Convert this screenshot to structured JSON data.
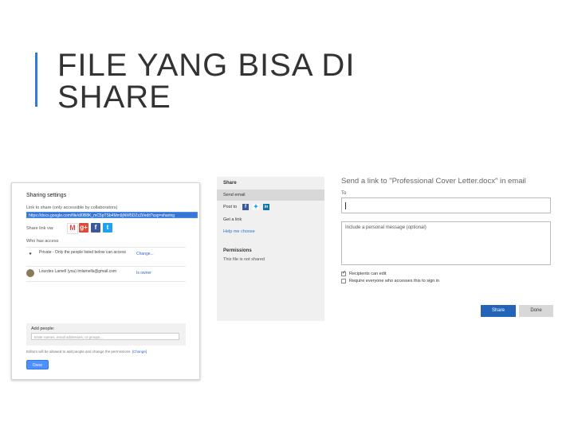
{
  "slide": {
    "title_line1": "FILE YANG BISA DI",
    "title_line2": "SHARE"
  },
  "colors": {
    "accent": "#2e7bd1",
    "google_blue": "#4d90fe",
    "onedrive_blue": "#2464b8"
  },
  "google_dialog": {
    "title": "Sharing settings",
    "link_label": "Link to share (only accessible by collaborators)",
    "link_value": "https://docs.google.com/file/d/0B8K_mC5pTSb4Mm9jNW5DZzZt/edit?usp=sharing",
    "share_via_label": "Share link via:",
    "services": [
      {
        "name": "gmail-icon",
        "glyph": "M"
      },
      {
        "name": "google-plus-icon",
        "glyph": "g+"
      },
      {
        "name": "facebook-icon",
        "glyph": "f"
      },
      {
        "name": "twitter-icon",
        "glyph": "t"
      }
    ],
    "access_label": "Who has access",
    "rows": [
      {
        "who": "Private - Only the people listed below can access",
        "action": "Change..."
      },
      {
        "who": "Lourdes Lamell (you) lmlamells@gmail.com",
        "action": "Is owner"
      }
    ],
    "add_people_label": "Add people:",
    "add_people_placeholder": "Enter names, email addresses, or groups...",
    "editors_note": "Editors will be allowed to add people and change the permissions.",
    "editors_change": "[Change]",
    "done_label": "Done"
  },
  "onedrive": {
    "panel_header": "Share",
    "send_email": "Send email",
    "post_to": "Post to",
    "get_link": "Get a link",
    "help_choose": "Help me choose",
    "permissions": "Permissions",
    "not_shared": "This file is not shared",
    "title": "Send a link to \"Professional Cover Letter.docx\" in email",
    "to_label": "To",
    "message_placeholder": "Include a personal message (optional)",
    "opt_edit": "Recipients can edit",
    "opt_signin": "Require everyone who accesses this to sign in",
    "share_button": "Share",
    "done_button": "Done"
  }
}
